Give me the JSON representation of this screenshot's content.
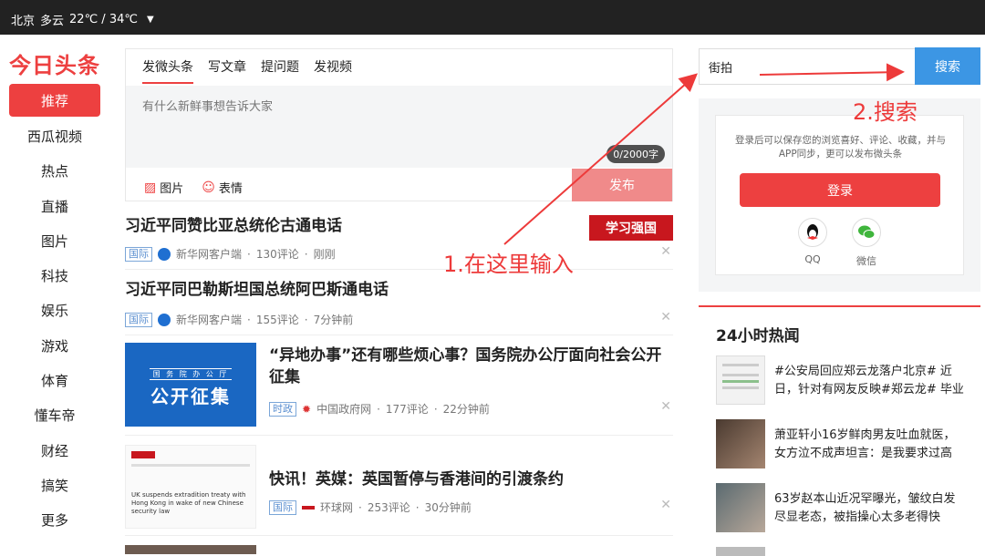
{
  "weather": {
    "city": "北京",
    "condition": "多云",
    "temp": "22℃ / 34℃"
  },
  "logo": "今日头条",
  "nav": [
    "推荐",
    "西瓜视频",
    "热点",
    "直播",
    "图片",
    "科技",
    "娱乐",
    "游戏",
    "体育",
    "懂车帝",
    "财经",
    "搞笑",
    "更多"
  ],
  "publisher": {
    "tabs": [
      "发微头条",
      "写文章",
      "提问题",
      "发视频"
    ],
    "placeholder": "有什么新鲜事想告诉大家",
    "counter": "0/2000字",
    "tool_image": "图片",
    "tool_emoji": "表情",
    "submit": "发布"
  },
  "feed": [
    {
      "title": "习近平同赞比亚总统伦古通电话",
      "tag": "国际",
      "source": "新华网客户端",
      "comments": "130评论",
      "time": "刚刚",
      "banner": "学习强国"
    },
    {
      "title": "习近平同巴勒斯坦国总统阿巴斯通电话",
      "tag": "国际",
      "source": "新华网客户端",
      "comments": "155评论",
      "time": "7分钟前"
    },
    {
      "title": "“异地办事”还有哪些烦心事？国务院办公厅面向社会公开征集",
      "tag": "时政",
      "source": "中国政府网",
      "comments": "177评论",
      "time": "22分钟前",
      "thumb_small": "国 务 院 办 公 厅",
      "thumb_big": "公开征集"
    },
    {
      "title": "快讯！英媒：英国暂停与香港间的引渡条约",
      "tag": "国际",
      "source": "环球网",
      "comments": "253评论",
      "time": "30分钟前",
      "thumb_text": "UK suspends extradition treaty with Hong Kong in wake of new Chinese security law"
    }
  ],
  "search": {
    "value": "街拍",
    "button": "搜索"
  },
  "login": {
    "text": "登录后可以保存您的浏览喜好、评论、收藏，并与APP同步，更可以发布微头条",
    "button": "登录",
    "qq": "QQ",
    "wechat": "微信"
  },
  "hot": {
    "title": "24小时热闻",
    "items": [
      "#公安局回应郑云龙落户北京# 近日，针对有网友反映#郑云龙# 毕业",
      "萧亚轩小16岁鲜肉男友吐血就医，女方泣不成声坦言：是我要求过高",
      "63岁赵本山近况罕曝光，皱纹白发尽显老态，被指操心太多老得快"
    ]
  },
  "annotations": {
    "step1": "1.在这里输入",
    "step2": "2.搜索"
  },
  "colors": {
    "brand": "#ed4040",
    "search": "#3c96e4",
    "annotation": "#ed3a3a"
  }
}
